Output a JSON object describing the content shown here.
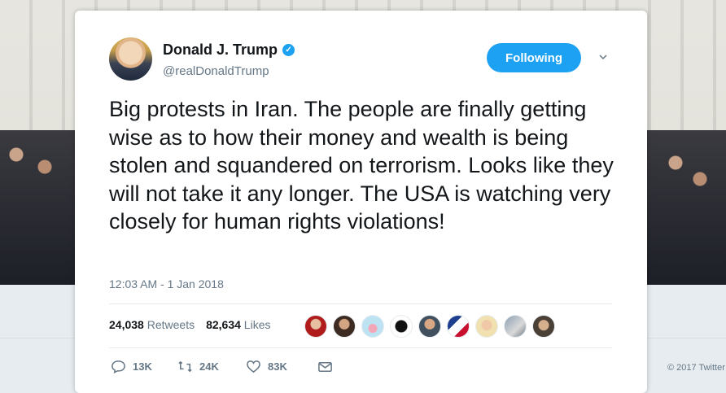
{
  "tweet": {
    "author_name": "Donald J. Trump",
    "handle": "@realDonaldTrump",
    "follow_label": "Following",
    "text": "Big protests in Iran. The people are finally getting wise as to how their money and wealth is being stolen and squandered on terrorism. Looks like they will not take it any longer. The USA is watching very closely for human rights violations!",
    "timestamp": "12:03 AM - 1 Jan 2018",
    "retweets_count": "24,038",
    "retweets_label": "Retweets",
    "likes_count": "82,634",
    "likes_label": "Likes",
    "actions": {
      "reply_count": "13K",
      "retweet_count": "24K",
      "like_count": "83K"
    }
  },
  "footer": {
    "copyright": "© 2017 Twitter"
  },
  "colors": {
    "accent": "#1da1f2",
    "text_primary": "#14171a",
    "text_secondary": "#657786"
  },
  "icons": {
    "verified": "verified-badge-icon",
    "caret": "chevron-down-icon",
    "reply": "reply-icon",
    "retweet": "retweet-icon",
    "like": "heart-icon",
    "message": "envelope-icon"
  }
}
